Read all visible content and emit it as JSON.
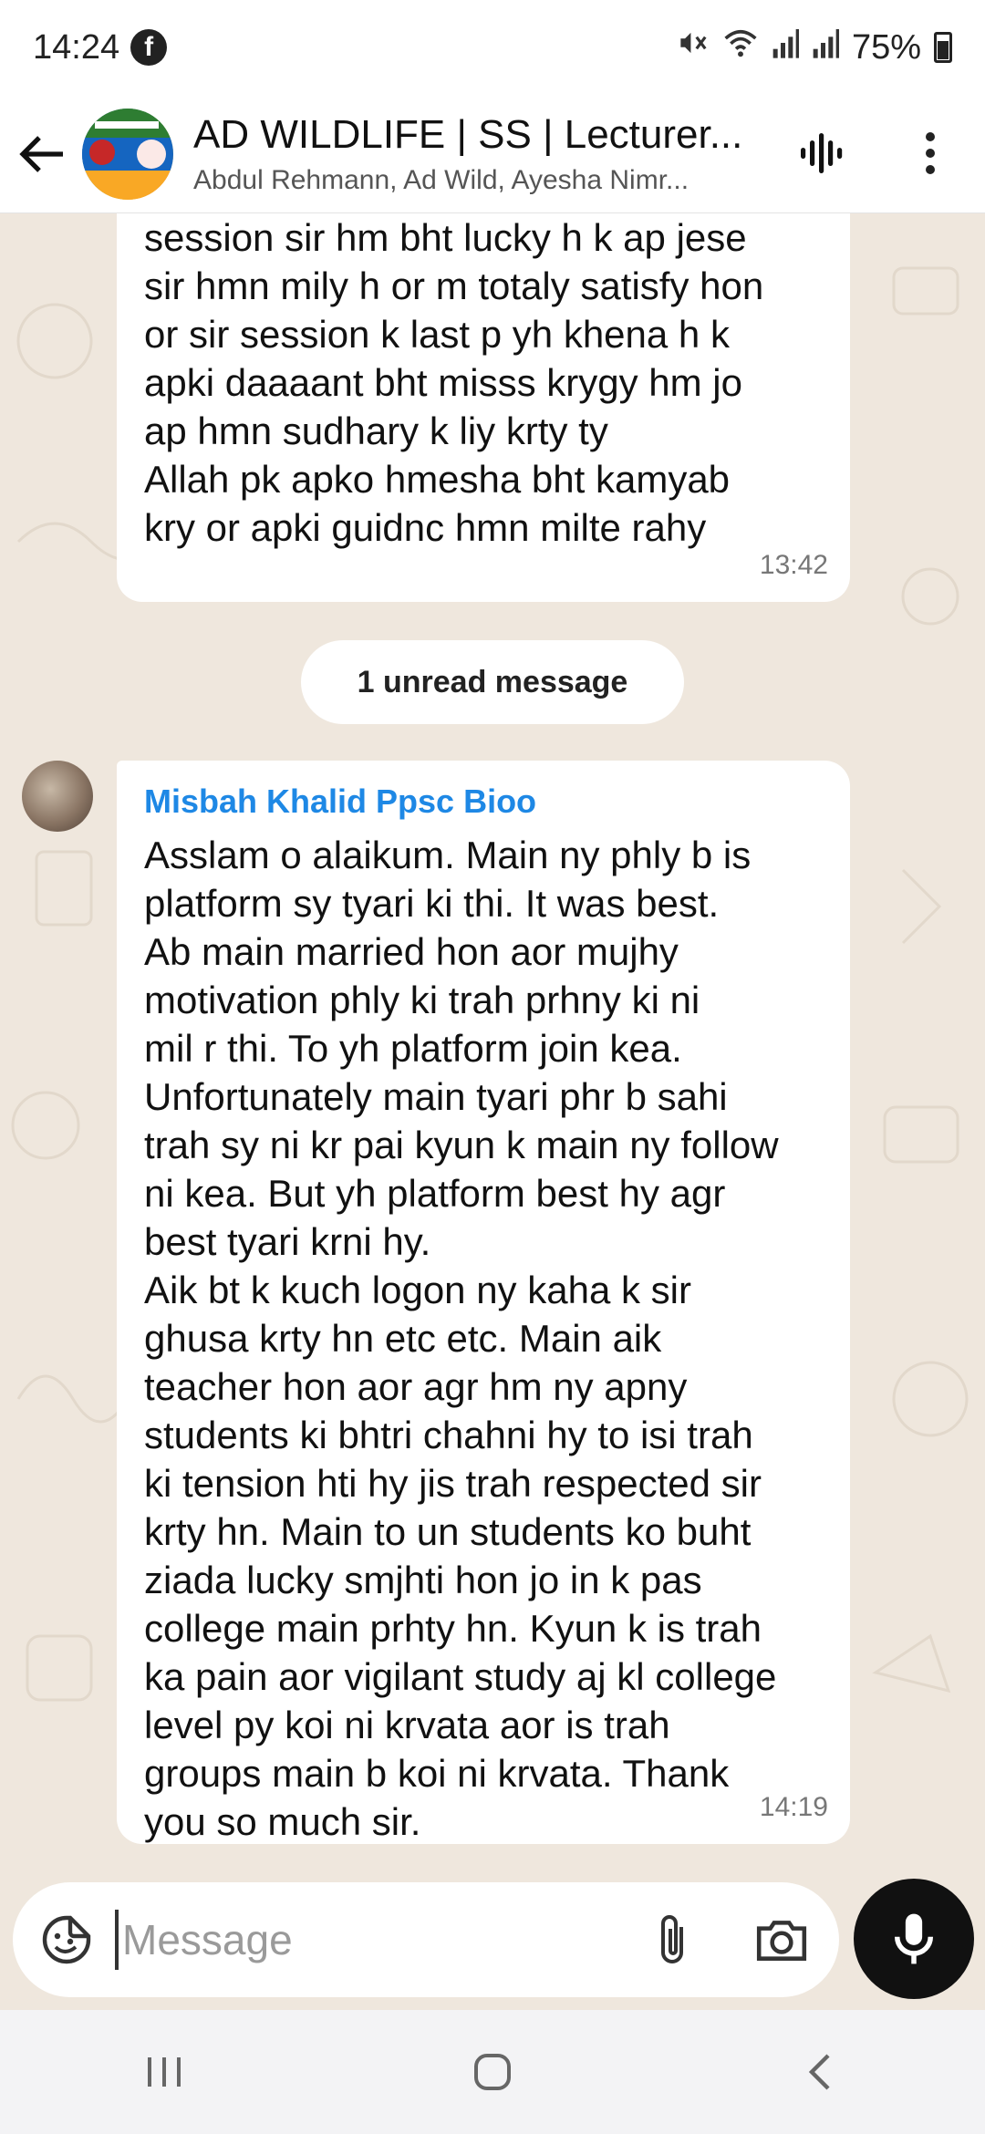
{
  "status_bar": {
    "time": "14:24",
    "battery": "75%",
    "icons": [
      "facebook-icon",
      "mute-icon",
      "wifi-icon",
      "signal-icon",
      "signal-icon",
      "battery-icon"
    ]
  },
  "header": {
    "title": "AD WILDLIFE | SS | Lecturer...",
    "subtitle": "Abdul Rehmann, Ad Wild, Ayesha Nimr...",
    "icons": [
      "back-arrow-icon",
      "group-avatar",
      "voice-call-icon",
      "more-vertical-icon"
    ]
  },
  "messages": [
    {
      "text": "session sir hm bht lucky h k ap jese\nsir hmn mily h or m totaly satisfy hon\nor sir session k last p yh khena h k\napki daaaant bht misss krygy hm jo\nap hmn sudhary k liy krty ty\nAllah pk apko hmesha bht kamyab\nkry or apki guidnc hmn milte rahy",
      "time": "13:42"
    }
  ],
  "unread_banner": "1 unread message",
  "incoming": {
    "sender": "Misbah Khalid Ppsc Bioo",
    "text": "Asslam o alaikum. Main ny phly b is\nplatform sy tyari ki thi. It was best.\nAb main married hon aor mujhy\nmotivation phly ki trah prhny ki ni\nmil r thi. To yh platform join kea.\nUnfortunately main tyari phr b sahi\ntrah sy ni kr pai kyun k main ny follow\nni kea. But yh platform best hy agr\nbest tyari krni hy.\nAik bt k kuch logon ny kaha k sir\nghusa krty hn etc etc. Main aik\nteacher hon aor agr hm ny apny\nstudents ki bhtri chahni hy to isi trah\nki tension hti hy jis trah respected sir\nkrty hn. Main to un students ko buht\nziada lucky smjhti hon jo in k pas\ncollege main prhty hn. Kyun k is trah\nka pain aor vigilant study aj kl college\nlevel py koi ni krvata aor is trah\ngroups main b koi ni krvata. Thank\nyou so much sir.",
    "time": "14:19",
    "name_color": "#1e88e5"
  },
  "composer": {
    "placeholder": "Message",
    "icons": [
      "sticker-icon",
      "paperclip-icon",
      "camera-icon",
      "mic-icon"
    ]
  },
  "nav": {
    "icons": [
      "recents-icon",
      "home-icon",
      "back-icon"
    ]
  },
  "colors": {
    "chat_background": "#efe7dd",
    "bubble": "#ffffff",
    "mic_button": "#111111"
  }
}
